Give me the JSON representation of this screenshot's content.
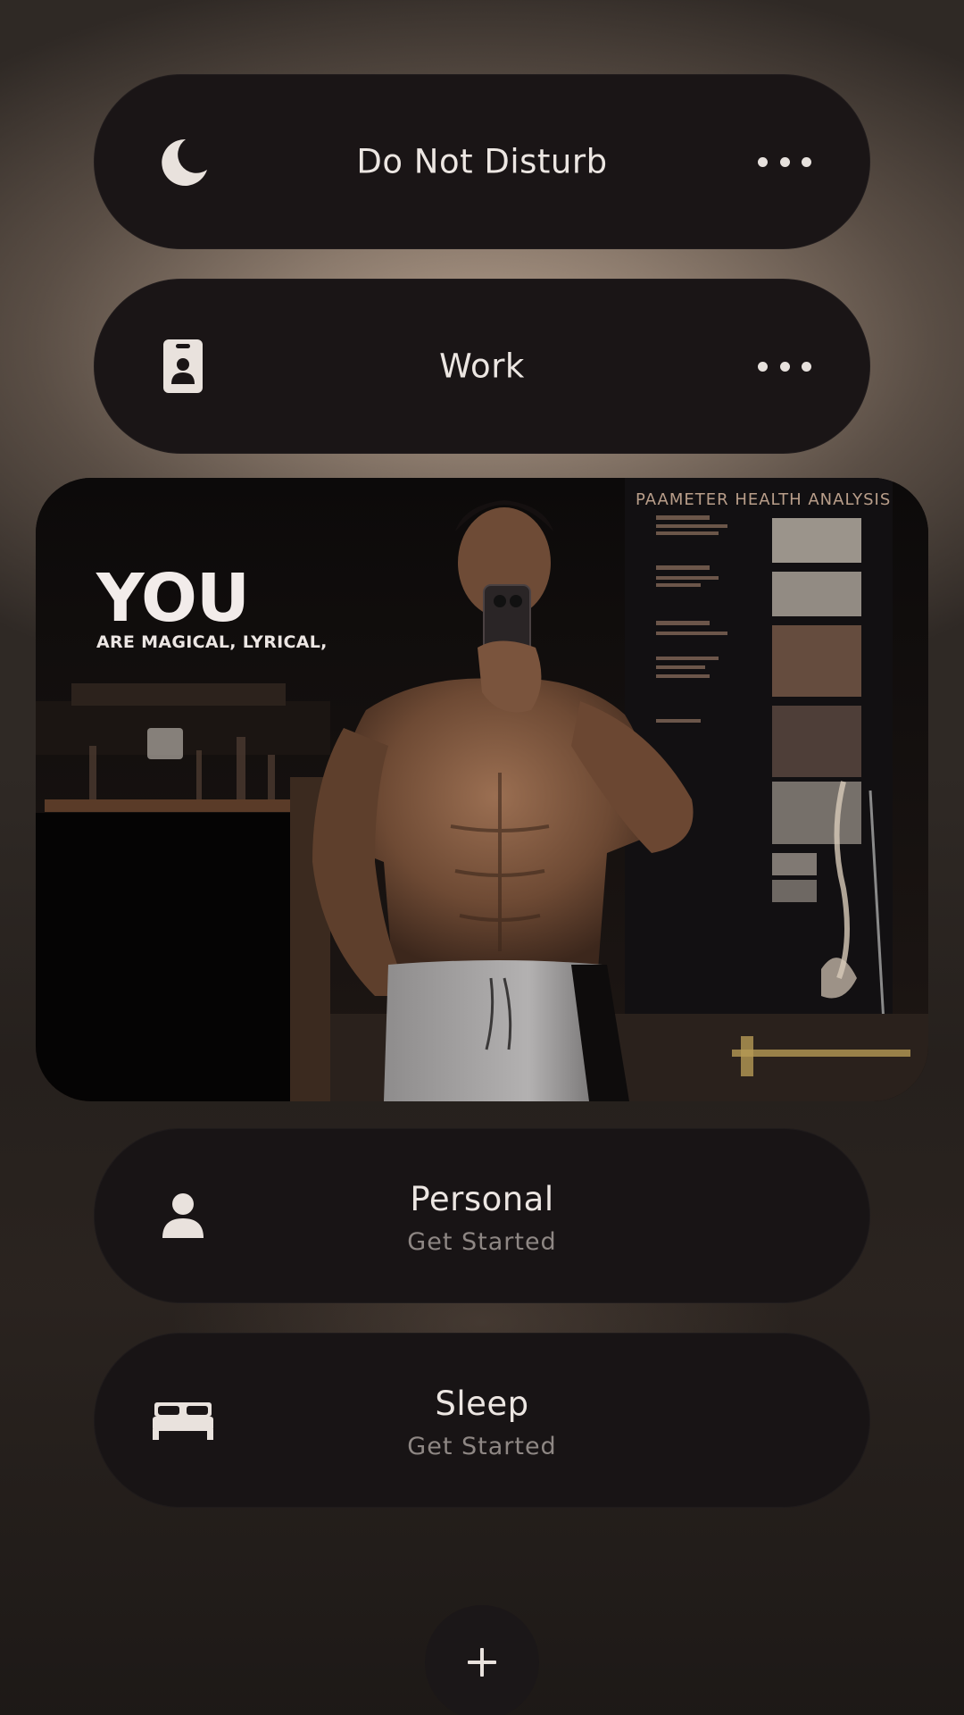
{
  "focus_modes": [
    {
      "title": "Do Not Disturb",
      "subtitle": "",
      "icon": "moon-icon",
      "has_more_menu": true
    },
    {
      "title": "Work",
      "subtitle": "",
      "icon": "id-badge-icon",
      "has_more_menu": true
    },
    {
      "title": "Personal",
      "subtitle": "Get Started",
      "icon": "person-icon",
      "has_more_menu": false
    },
    {
      "title": "Sleep",
      "subtitle": "Get Started",
      "icon": "bed-icon",
      "has_more_menu": false
    }
  ],
  "photo_overlay": {
    "title": "YOU",
    "subtitle": "ARE MAGICAL, LYRICAL,",
    "poster_text": "PAAMETER HEALTH ANALYSIS",
    "description_icon": "gym-mirror-selfie-photo"
  },
  "add_button": {
    "icon": "plus-icon"
  },
  "colors": {
    "pill_background": "#1a1516",
    "text_primary": "#ece6e2",
    "text_secondary": "#8e8784",
    "background_glow": "#b19c8a"
  }
}
